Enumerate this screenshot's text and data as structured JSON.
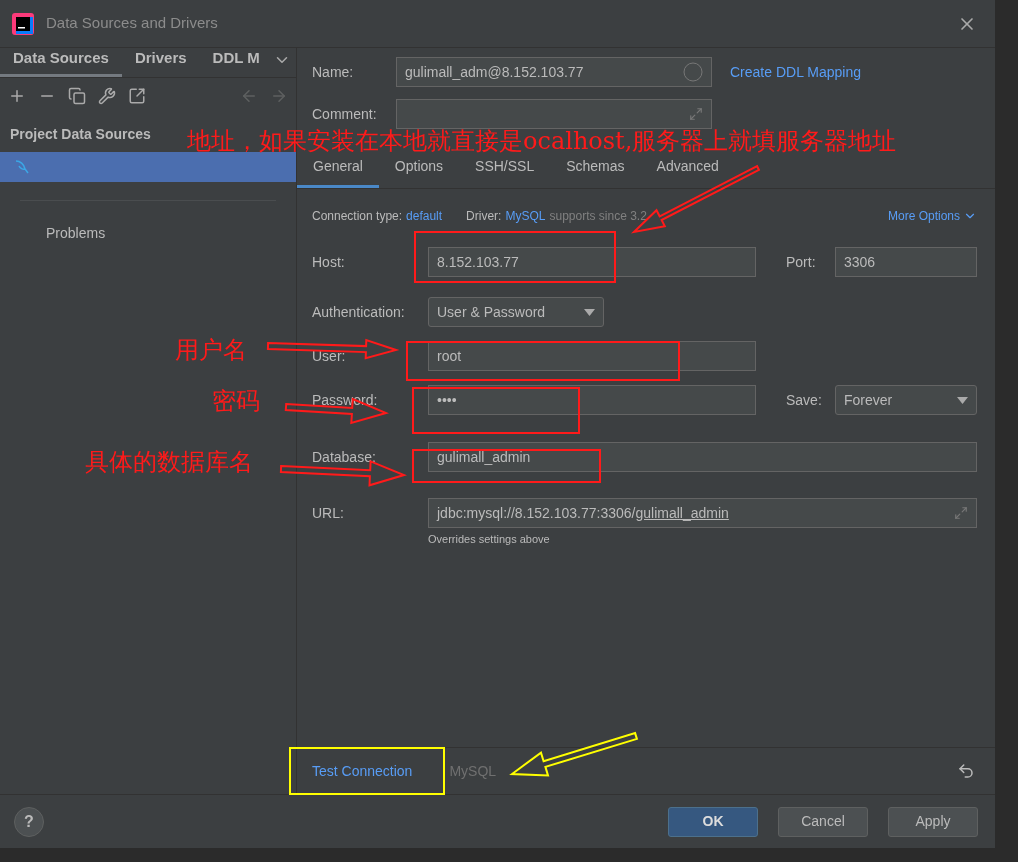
{
  "window": {
    "title": "Data Sources and Drivers"
  },
  "sidebar": {
    "tabs": [
      {
        "label": "Data Sources",
        "selected": true
      },
      {
        "label": "Drivers",
        "selected": false
      },
      {
        "label": "DDL M",
        "selected": false
      }
    ],
    "section_title": "Project Data Sources",
    "items": [
      {
        "kind": "mysql",
        "selected": true
      }
    ],
    "problems": "Problems"
  },
  "form": {
    "name_label": "Name:",
    "name": "gulimall_adm@8.152.103.77",
    "ddl_link": "Create DDL Mapping",
    "comment_label": "Comment:",
    "tabs": [
      {
        "label": "General",
        "selected": true
      },
      {
        "label": "Options",
        "selected": false
      },
      {
        "label": "SSH/SSL",
        "selected": false
      },
      {
        "label": "Schemas",
        "selected": false
      },
      {
        "label": "Advanced",
        "selected": false
      }
    ],
    "connection_type_label": "Connection type:",
    "connection_type": "default",
    "driver_label": "Driver:",
    "driver": "MySQL",
    "driver_note": "supports since 3.2",
    "more_options": "More Options",
    "host_label": "Host:",
    "host": "8.152.103.77",
    "port_label": "Port:",
    "port": "3306",
    "auth_label": "Authentication:",
    "auth": "User & Password",
    "user_label": "User:",
    "user": "root",
    "password_label": "Password:",
    "password": "••••",
    "save_label": "Save:",
    "save": "Forever",
    "database_label": "Database:",
    "database": "gulimall_admin",
    "url_label": "URL:",
    "url_prefix": "jdbc:mysql://8.152.103.77:3306/",
    "url_db": "gulimall_admin",
    "url_note": "Overrides settings above"
  },
  "footer": {
    "test_connection": "Test Connection",
    "driver_name": "MySQL",
    "help": "?",
    "buttons": [
      {
        "label": "OK",
        "kind": "primary"
      },
      {
        "label": "Cancel",
        "kind": "normal"
      },
      {
        "label": "Apply",
        "kind": "normal"
      }
    ]
  },
  "annotations": [
    {
      "text": "地址，如果安装在本地就直接是ocalhost,服务器上就填服务器地址",
      "color": "#ff1a1a"
    },
    {
      "text": "用户名",
      "color": "#ff1a1a"
    },
    {
      "text": "密码",
      "color": "#ff1a1a"
    },
    {
      "text": "具体的数据库名",
      "color": "#ff1a1a"
    }
  ]
}
